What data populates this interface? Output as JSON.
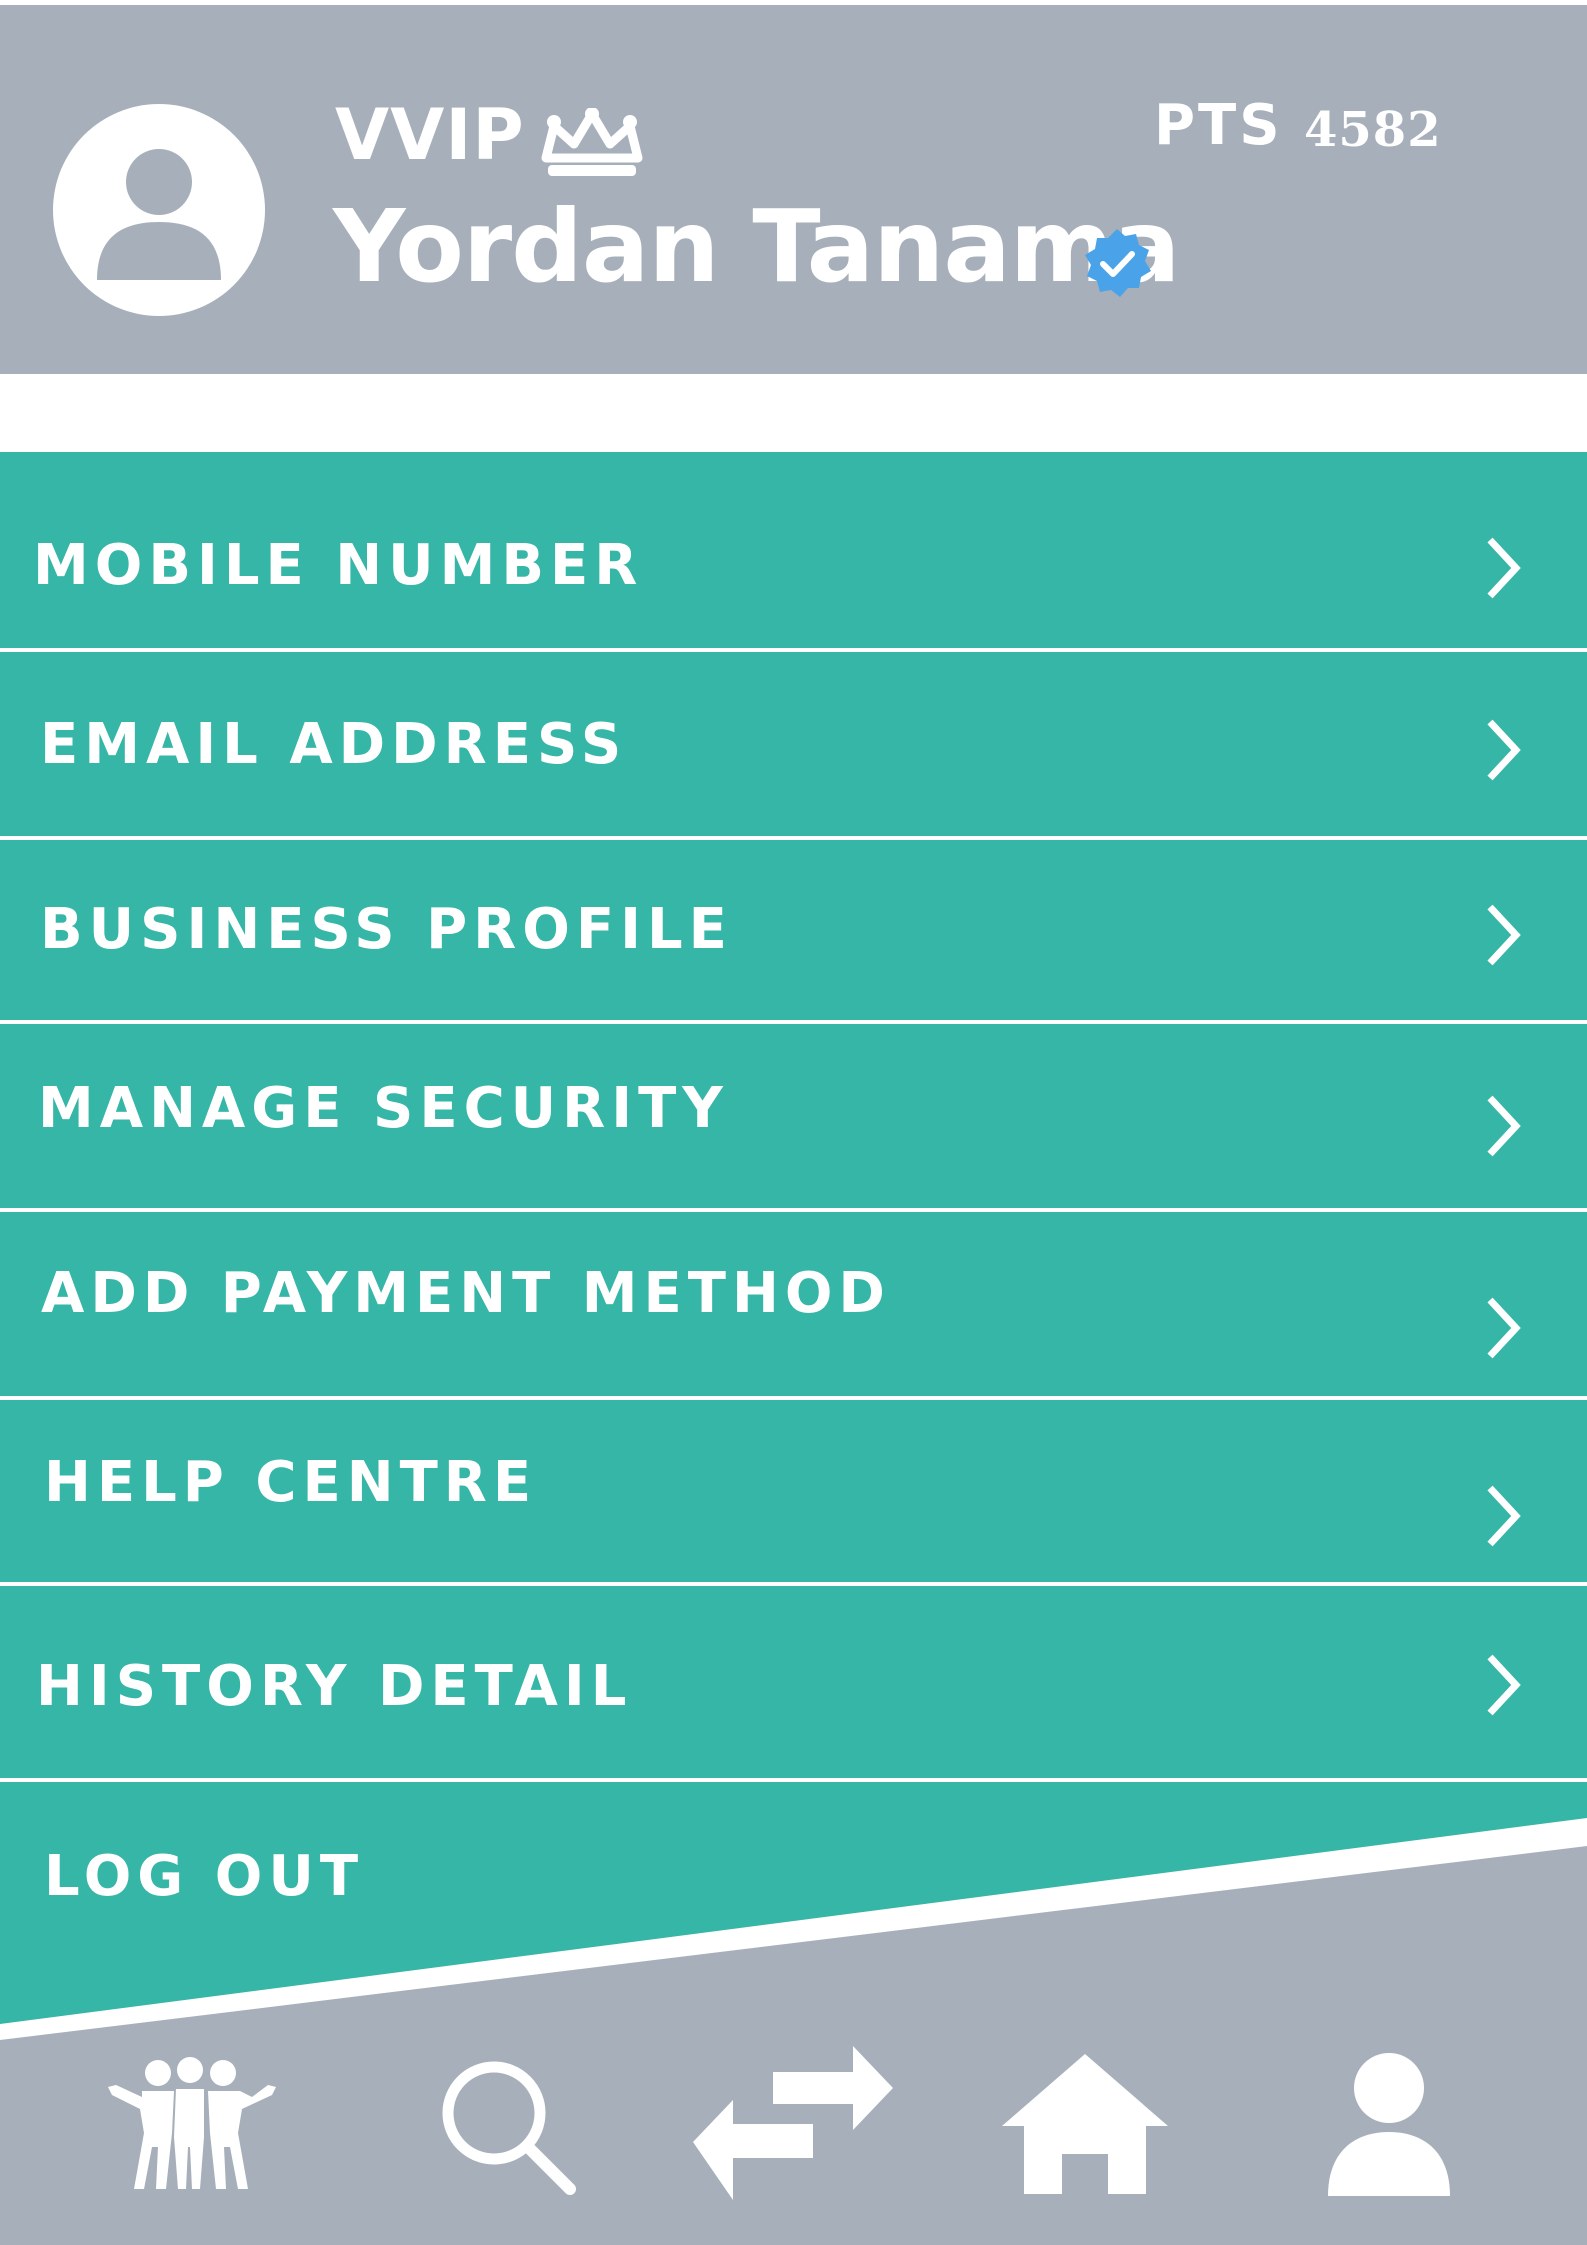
{
  "header": {
    "tier": "VVIP",
    "user_name": "Yordan Tanama",
    "points_label": "PTS",
    "points_value": "4582"
  },
  "menu": {
    "items": [
      {
        "label": "MOBILE NUMBER"
      },
      {
        "label": "EMAIL ADDRESS"
      },
      {
        "label": "BUSINESS PROFILE"
      },
      {
        "label": "MANAGE SECURITY"
      },
      {
        "label": "ADD PAYMENT METHOD"
      },
      {
        "label": "HELP CENTRE"
      },
      {
        "label": "HISTORY DETAIL"
      }
    ],
    "logout_label": "LOG OUT"
  },
  "bottom_nav": {
    "items": [
      {
        "icon": "community-icon"
      },
      {
        "icon": "search-icon"
      },
      {
        "icon": "transfer-icon"
      },
      {
        "icon": "home-icon"
      },
      {
        "icon": "profile-icon"
      }
    ]
  },
  "colors": {
    "header_bg": "#a7b0ba",
    "menu_bg": "#35b6a7",
    "text": "#ffffff",
    "verified_badge": "#4aa3e8"
  }
}
